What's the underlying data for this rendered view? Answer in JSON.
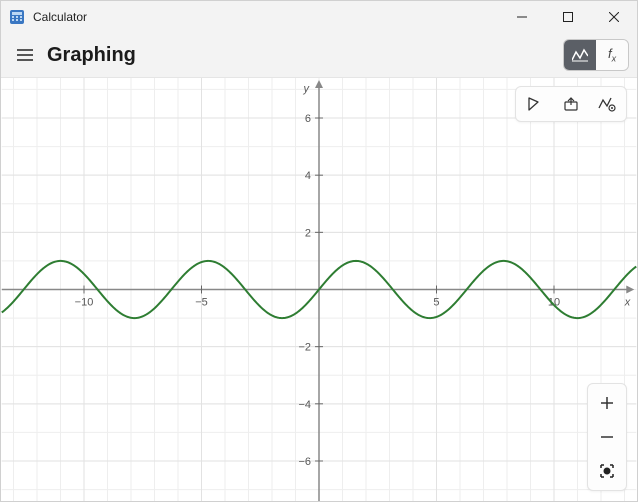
{
  "window": {
    "title": "Calculator"
  },
  "header": {
    "mode_title": "Graphing"
  },
  "toolbox": {
    "trace": "Trace",
    "share": "Share",
    "options": "Graph options"
  },
  "zoom": {
    "in": "+",
    "out": "−",
    "fit": "⦿"
  },
  "axes": {
    "x_label": "x",
    "y_label": "y"
  },
  "chart_data": {
    "type": "line",
    "title": "",
    "xlabel": "x",
    "ylabel": "y",
    "xlim": [
      -13.5,
      13.5
    ],
    "ylim": [
      -7.4,
      7.4
    ],
    "x_ticks": [
      -10,
      -5,
      5,
      10
    ],
    "y_ticks": [
      -6,
      -4,
      -2,
      2,
      4,
      6
    ],
    "series": [
      {
        "name": "sin(x)",
        "color": "#2e7d32",
        "function": "sin",
        "amplitude": 1,
        "period": 6.2832,
        "phase": 0
      }
    ]
  }
}
